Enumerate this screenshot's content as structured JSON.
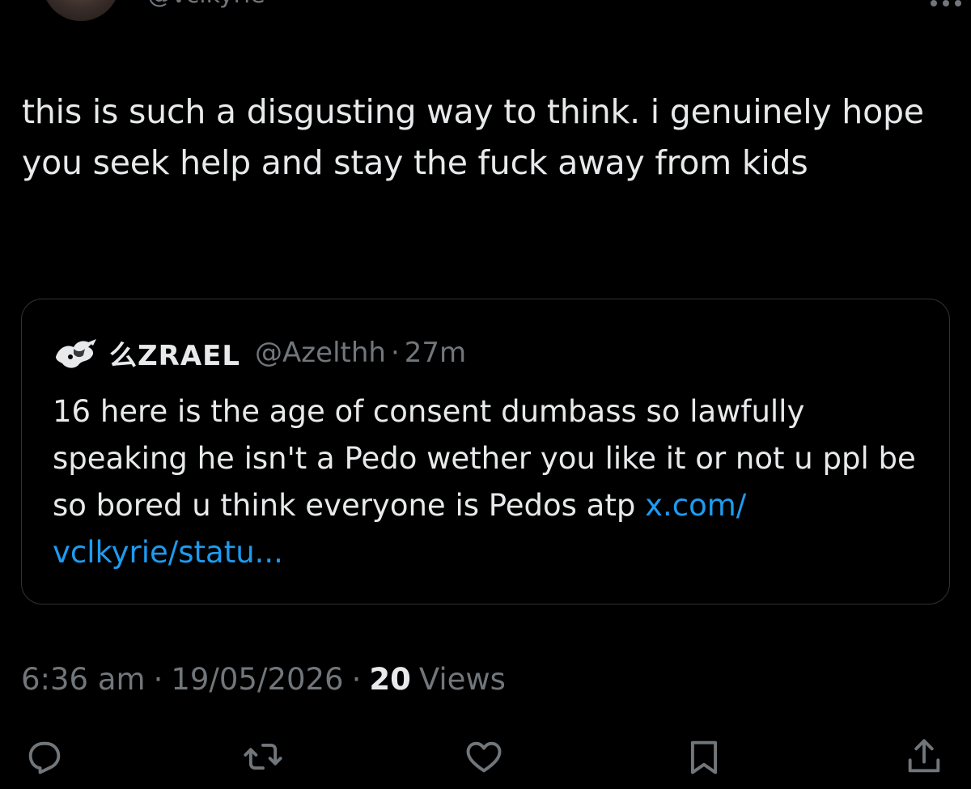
{
  "author": {
    "handle": "@vclkyrie",
    "icons": {
      "avatar": "avatar-photo",
      "more": "more-horizontal-icon"
    }
  },
  "tweet": {
    "text": "this is such a disgusting way to think. i genuinely hope you seek help and stay the fuck away from kids"
  },
  "quote": {
    "avatar_icon": "avatar-icon",
    "name": "么ZRAEL",
    "handle": "@Azelthh",
    "separator": "·",
    "time": "27m",
    "text": "16 here is the age of consent dumbass so lawfully speaking he isn't a Pedo wether you like it or not u ppl be so bored u think everyone is Pedos atp",
    "link_line1": "x.com/",
    "link_line2": "vclkyrie/statu..."
  },
  "meta": {
    "time": "6:36 am",
    "separator": "·",
    "date": "19/05/2026",
    "views_count": "20",
    "views_label": "Views"
  },
  "actions": [
    {
      "name": "reply",
      "icon": "reply-icon"
    },
    {
      "name": "retweet",
      "icon": "retweet-icon"
    },
    {
      "name": "like",
      "icon": "heart-icon"
    },
    {
      "name": "bookmark",
      "icon": "bookmark-icon"
    },
    {
      "name": "share",
      "icon": "share-icon"
    }
  ],
  "colors": {
    "background": "#000000",
    "text": "#e7e9ea",
    "muted": "#71767b",
    "link": "#1d9bf0",
    "border": "#2f3336"
  }
}
